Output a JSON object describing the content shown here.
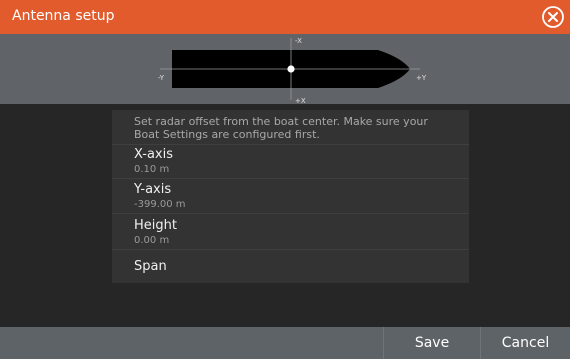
{
  "window": {
    "title": "Antenna setup",
    "accent_color": "#e25b2c",
    "close_icon": "close-circle-icon"
  },
  "diagram": {
    "minus_x_label": "-X",
    "plus_x_label": "+X",
    "minus_y_label": "-Y",
    "plus_y_label": "+Y"
  },
  "panel": {
    "description": "Set radar offset from the boat center. Make sure your Boat Settings are configured first.",
    "rows": [
      {
        "label": "X-axis",
        "value": "0.10 m"
      },
      {
        "label": "Y-axis",
        "value": "-399.00 m"
      },
      {
        "label": "Height",
        "value": "0.00 m"
      },
      {
        "label": "Span",
        "value": ""
      }
    ]
  },
  "footer": {
    "save_label": "Save",
    "cancel_label": "Cancel"
  }
}
